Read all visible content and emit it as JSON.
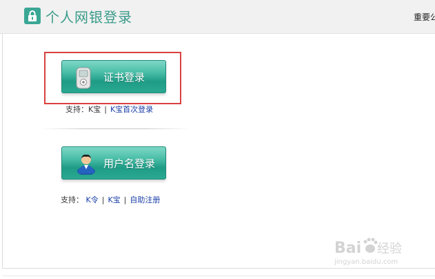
{
  "header": {
    "title": "个人网银登录",
    "notice_link": "重要公"
  },
  "cert_login": {
    "label": "证书登录",
    "support_label": "支持：K宝",
    "support_sep": "|",
    "support_link": "K宝首次登录"
  },
  "user_login": {
    "label": "用户名登录",
    "support_label": "支持：",
    "support_links": [
      "K令",
      "K宝",
      "自助注册"
    ],
    "support_sep": "|"
  },
  "watermark": {
    "brand": "Bai",
    "brand_suffix": "经验",
    "url": "jingyan.baidu.com"
  },
  "colors": {
    "accent": "#3aa795",
    "title": "#3a9b8a",
    "highlight": "#d94040",
    "link": "#1a3ea6"
  }
}
